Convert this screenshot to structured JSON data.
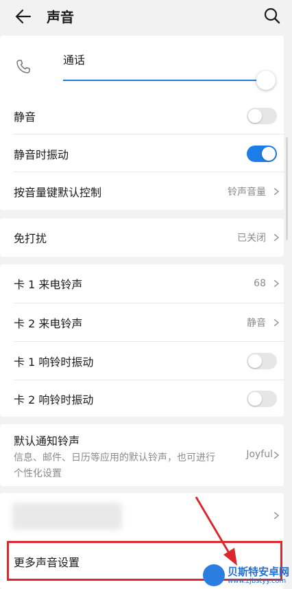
{
  "header": {
    "title": "声音"
  },
  "call_volume": {
    "label": "通话",
    "level": 1.0
  },
  "group1": [
    {
      "label": "静音",
      "toggle": false
    },
    {
      "label": "静音时振动",
      "toggle": true
    },
    {
      "label": "按音量键默认控制",
      "value": "铃声音量"
    }
  ],
  "dnd": {
    "label": "免打扰",
    "value": "已关闭"
  },
  "group3": [
    {
      "label": "卡 1 来电铃声",
      "value": "68"
    },
    {
      "label": "卡 2 来电铃声",
      "value": "静音"
    },
    {
      "label": "卡 1 响铃时振动",
      "toggle": false
    },
    {
      "label": "卡 2 响铃时振动",
      "toggle": false
    }
  ],
  "notification": {
    "title": "默认通知铃声",
    "subtitle": "信息、邮件、日历等应用的默认铃声，也可进行个性化设置",
    "value": "Joyful"
  },
  "more": {
    "label": "更多声音设置"
  },
  "watermark": {
    "name": "贝斯特安卓网",
    "url": "www.zjbstyy.com"
  },
  "colors": {
    "accent": "#1e7ce8",
    "highlight": "#d9292e"
  }
}
